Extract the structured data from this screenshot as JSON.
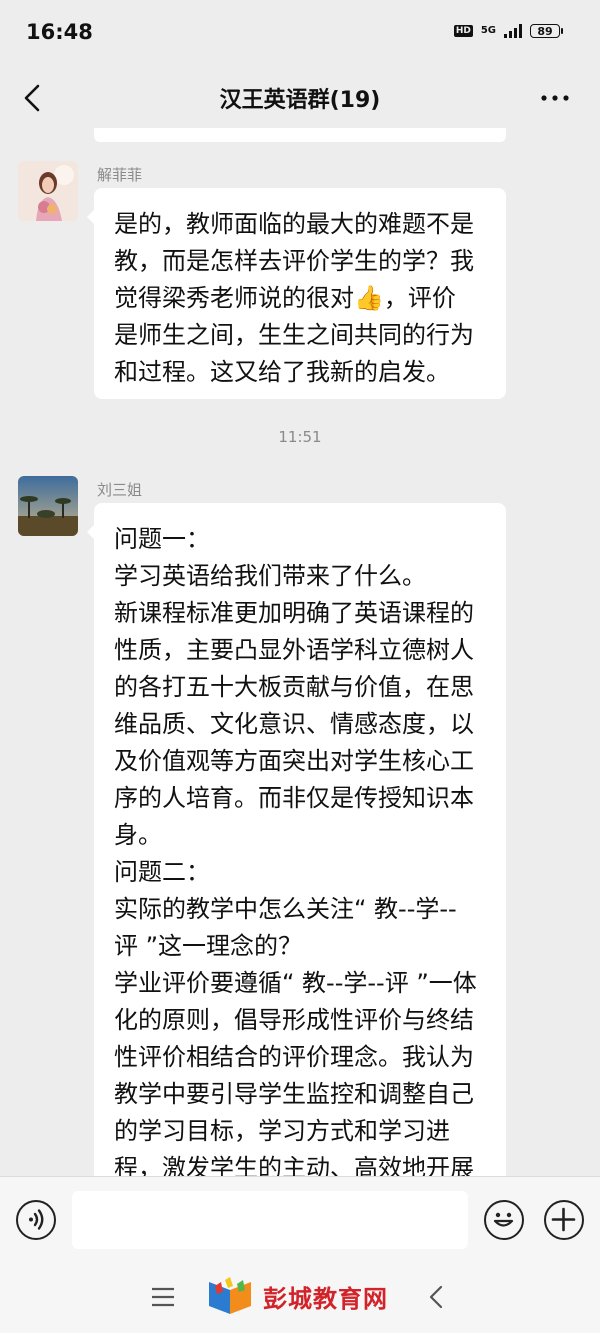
{
  "status_bar": {
    "time": "16:48",
    "hd_badge": "HD",
    "network": "5G",
    "battery": "89"
  },
  "nav": {
    "title": "汉王英语群(19)",
    "back_icon": "chevron-left-icon",
    "more_icon": "more-dots-icon"
  },
  "messages": [
    {
      "sender": "解菲菲",
      "lines": [
        "是的，教师面临的最大的难题不是",
        "教，而是怎样去评价学生的学？我",
        "觉得梁秀老师说的很对👍，评价",
        "是师生之间，生生之间共同的行为",
        "和过程。这又给了我新的启发。"
      ]
    },
    {
      "sender": "刘三姐",
      "lines": [
        "问题一：",
        "学习英语给我们带来了什么。",
        "新课程标准更加明确了英语课程的",
        "性质，主要凸显外语学科立德树人",
        "的各打五十大板贡献与价值，在思",
        "维品质、文化意识、情感态度，以",
        "及价值观等方面突出对学生核心工",
        "序的人培育。而非仅是传授知识本",
        "身。",
        "问题二：",
        "实际的教学中怎么关注“ 教--学--",
        "评 ”这一理念的？",
        "学业评价要遵循“ 教--学--评 ”一体",
        "化的原则，倡导形成性评价与终结",
        "性评价相结合的评价理念。我认为",
        "教学中要引导学生监控和调整自己",
        "的学习目标，学习方式和学习进",
        "程，激发学生的主动、高效地开展"
      ]
    }
  ],
  "time_separator": "11:51",
  "input_bar": {
    "value": "",
    "voice_icon": "voice-icon",
    "emoji_icon": "emoji-icon",
    "plus_icon": "plus-icon"
  },
  "system_nav": {
    "menu_icon": "menu-icon",
    "back_icon": "back-triangle-icon"
  },
  "watermark": {
    "text": "彭城教育网"
  }
}
